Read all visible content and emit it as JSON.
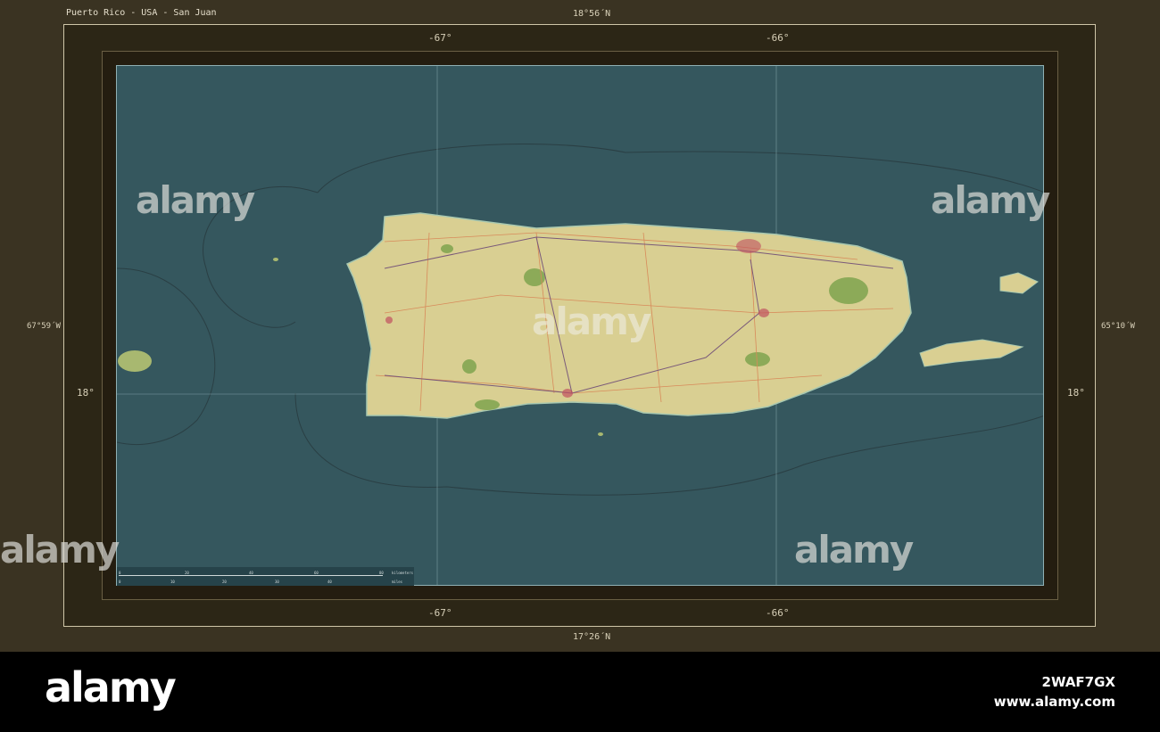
{
  "title": "Puerto Rico - USA - San Juan",
  "coords": {
    "top_lat": "18°56´N",
    "bottom_lat": "17°26´N",
    "left_lon": "67°59´W",
    "right_lon": "65°10´W",
    "grid_lon": [
      "-67°",
      "-66°"
    ],
    "grid_lat": "18°"
  },
  "scale": {
    "km_ticks": [
      "0",
      "20",
      "40",
      "60",
      "80"
    ],
    "km_unit": "kilometers",
    "mi_ticks": [
      "0",
      "10",
      "20",
      "30",
      "40"
    ],
    "mi_unit": "miles"
  },
  "colors": {
    "sea": "#35575e",
    "land": "#d9cf92",
    "frame": "#3a3322"
  },
  "watermark": "alamy",
  "banner": {
    "brand": "alamy",
    "code": "2WAF7GX",
    "url": "www.alamy.com"
  }
}
